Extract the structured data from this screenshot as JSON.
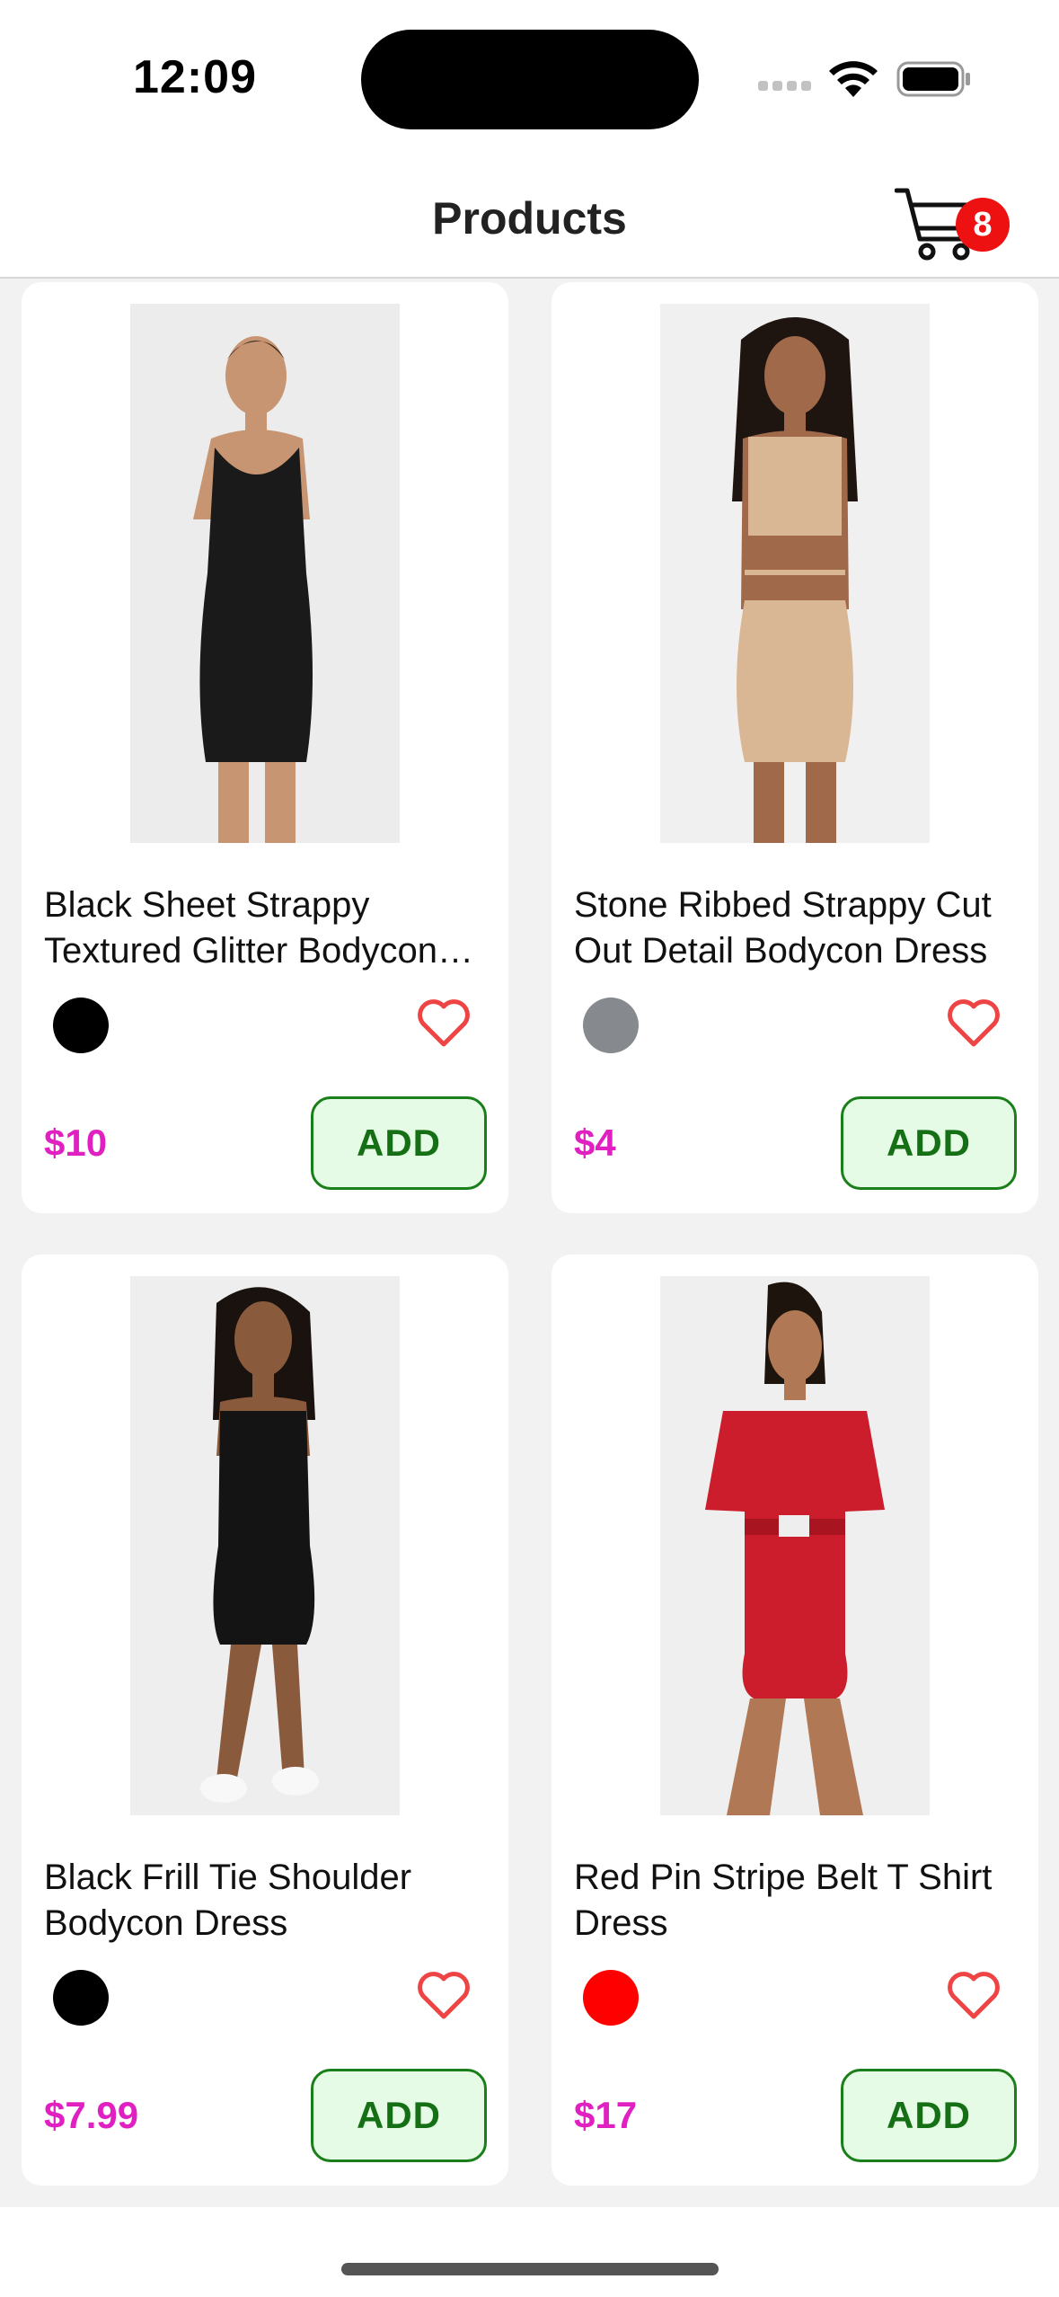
{
  "status_bar": {
    "time": "12:09"
  },
  "header": {
    "title": "Products",
    "cart_count": "8"
  },
  "products": [
    {
      "name": "Black Sheet Strappy Textured Glitter Bodycon Dress",
      "price": "$10",
      "add_label": "ADD",
      "swatch_color": "#000000",
      "dress_color": "#1a1a1a"
    },
    {
      "name": "Stone Ribbed Strappy Cut Out Detail Bodycon Dress",
      "price": "$4",
      "add_label": "ADD",
      "swatch_color": "#868a8e",
      "dress_color": "#d9b694"
    },
    {
      "name": "Black Frill Tie Shoulder Bodycon Dress",
      "price": "$7.99",
      "add_label": "ADD",
      "swatch_color": "#000000",
      "dress_color": "#141414"
    },
    {
      "name": "Red Pin Stripe Belt T Shirt Dress",
      "price": "$17",
      "add_label": "ADD",
      "swatch_color": "#ff0000",
      "dress_color": "#cc1d2c"
    }
  ],
  "colors": {
    "price": "#e020c0",
    "add_button_text": "#157015",
    "add_button_bg": "#e6fbe6",
    "heart": "#ee4444",
    "badge": "#ee1111"
  }
}
